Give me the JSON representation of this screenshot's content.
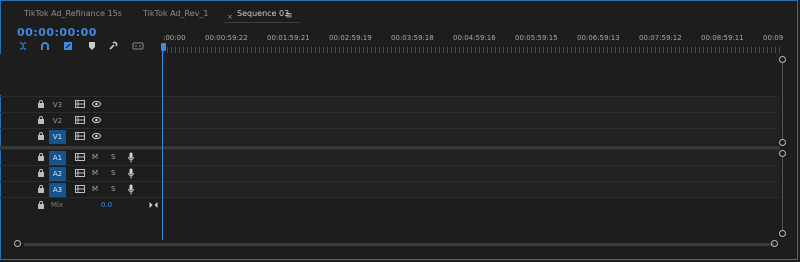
{
  "tabs": [
    {
      "label": "TikTok Ad_Refinance 15s",
      "active": false
    },
    {
      "label": "TikTok Ad_Rev_1",
      "active": false
    },
    {
      "label": "Sequence 03",
      "active": true
    }
  ],
  "tab_close_glyph": "×",
  "tab_menu_glyph": "≡",
  "timecode": "00:00:00:00",
  "tools": [
    "snap-icon",
    "magnet-icon",
    "linked-selection-icon",
    "marker-icon",
    "wrench-icon",
    "captions-icon"
  ],
  "ruler": {
    "labels": [
      ":00:00",
      "00:00:59:22",
      "00:01:59:21",
      "00:02:59:19",
      "00:03:59:18",
      "00:04:59:16",
      "00:05:59:15",
      "00:06:59:13",
      "00:07:59:12",
      "00:08:59:11",
      "00:09"
    ]
  },
  "video_tracks": [
    {
      "name": "V3",
      "active": false
    },
    {
      "name": "V2",
      "active": false
    },
    {
      "name": "V1",
      "active": true
    }
  ],
  "audio_tracks": [
    {
      "name": "A1",
      "mute": "M",
      "solo": "S",
      "active": true
    },
    {
      "name": "A2",
      "mute": "M",
      "solo": "S",
      "active": true
    },
    {
      "name": "A3",
      "mute": "M",
      "solo": "S",
      "active": true
    }
  ],
  "mix": {
    "label": "Mix",
    "value": "0.0"
  },
  "colors": {
    "accent": "#3e8ae0",
    "active_track": "#17548e",
    "background": "#1d1d1d"
  }
}
